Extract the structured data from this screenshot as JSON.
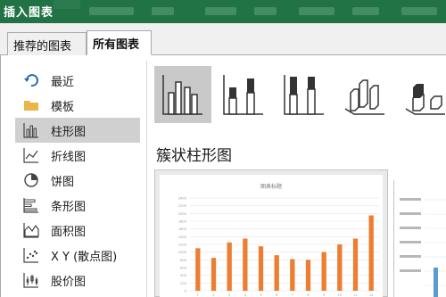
{
  "window": {
    "title": "插入图表"
  },
  "tabs": [
    {
      "label": "推荐的图表",
      "active": false
    },
    {
      "label": "所有图表",
      "active": true
    }
  ],
  "sidebar": {
    "items": [
      {
        "label": "最近",
        "icon": "recent-icon",
        "selected": false
      },
      {
        "label": "模板",
        "icon": "folder-icon",
        "selected": false
      },
      {
        "label": "柱形图",
        "icon": "column-chart-icon",
        "selected": true
      },
      {
        "label": "折线图",
        "icon": "line-chart-icon",
        "selected": false
      },
      {
        "label": "饼图",
        "icon": "pie-chart-icon",
        "selected": false
      },
      {
        "label": "条形图",
        "icon": "bar-chart-icon",
        "selected": false
      },
      {
        "label": "面积图",
        "icon": "area-chart-icon",
        "selected": false
      },
      {
        "label": "X Y (散点图)",
        "icon": "scatter-chart-icon",
        "selected": false
      },
      {
        "label": "股价图",
        "icon": "stock-chart-icon",
        "selected": false
      }
    ]
  },
  "subtypes": [
    {
      "name": "clustered-column",
      "selected": true
    },
    {
      "name": "stacked-column",
      "selected": false
    },
    {
      "name": "percent-stacked-column",
      "selected": false
    },
    {
      "name": "3d-clustered-column",
      "selected": false
    },
    {
      "name": "3d-stacked-column",
      "selected": false
    }
  ],
  "main": {
    "section_title": "簇状柱形图"
  },
  "colors": {
    "titlebar": "#217346",
    "bar": "#ed7d31",
    "bar_alt": "#5b9bd5",
    "icon_accent": "#1e6fb8"
  },
  "chart_data": {
    "type": "bar",
    "title": "图表标题",
    "categories": [
      "1",
      "2",
      "3",
      "4",
      "5",
      "6",
      "7",
      "8",
      "9",
      "10",
      "11",
      "12"
    ],
    "values": [
      1100,
      850,
      1250,
      1350,
      1150,
      920,
      820,
      800,
      1000,
      1200,
      1350,
      1950
    ],
    "yticks": [
      "0",
      "200",
      "400",
      "600",
      "800",
      "1000",
      "1200",
      "1400",
      "1600",
      "1800",
      "2000",
      "2200",
      "2400"
    ],
    "ylim": [
      0,
      2400
    ],
    "grid": true,
    "legend": "none"
  }
}
